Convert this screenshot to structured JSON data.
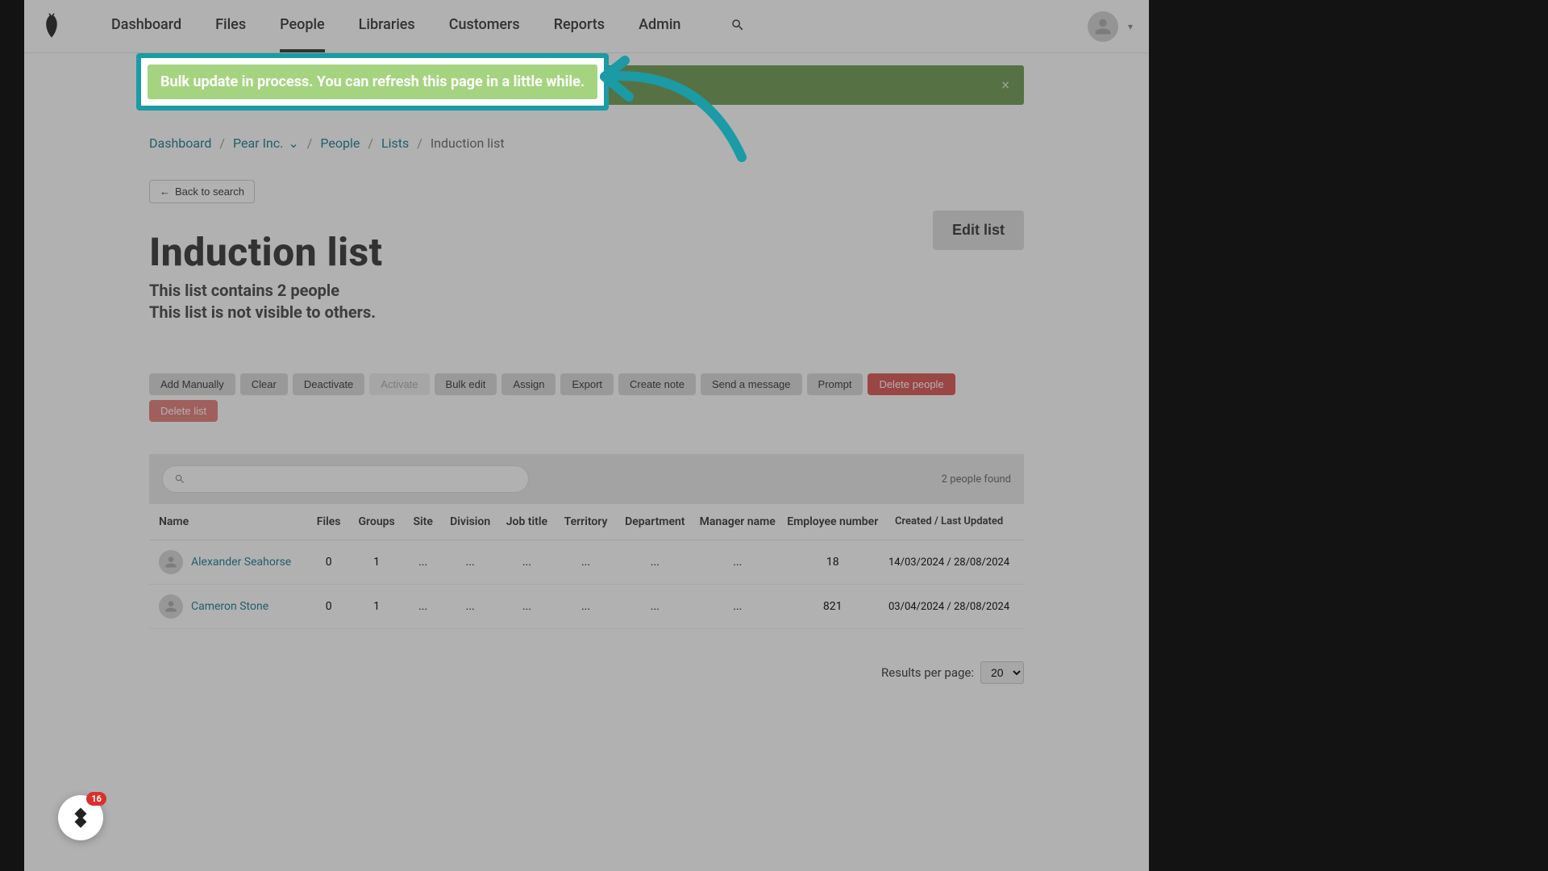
{
  "nav": {
    "items": [
      "Dashboard",
      "Files",
      "People",
      "Libraries",
      "Customers",
      "Reports",
      "Admin"
    ],
    "active_index": 2
  },
  "alert": {
    "text": "Bulk update in process. You can refresh this page in a little while."
  },
  "breadcrumb": {
    "items": [
      "Dashboard",
      "Pear Inc.",
      "People",
      "Lists",
      "Induction list"
    ]
  },
  "back_button": "Back to search",
  "page": {
    "title": "Induction list",
    "subtitle_line1": "This list contains 2 people",
    "subtitle_line2": "This list is not visible to others.",
    "edit_button": "Edit list"
  },
  "actions": [
    {
      "label": "Add Manually",
      "style": "normal"
    },
    {
      "label": "Clear",
      "style": "normal"
    },
    {
      "label": "Deactivate",
      "style": "normal"
    },
    {
      "label": "Activate",
      "style": "disabled"
    },
    {
      "label": "Bulk edit",
      "style": "normal"
    },
    {
      "label": "Assign",
      "style": "normal"
    },
    {
      "label": "Export",
      "style": "normal"
    },
    {
      "label": "Create note",
      "style": "normal"
    },
    {
      "label": "Send a message",
      "style": "normal"
    },
    {
      "label": "Prompt",
      "style": "normal"
    },
    {
      "label": "Delete people",
      "style": "danger"
    },
    {
      "label": "Delete list",
      "style": "danger-light"
    }
  ],
  "search": {
    "results_count": "2 people found"
  },
  "table": {
    "headers": [
      "Name",
      "Files",
      "Groups",
      "Site",
      "Division",
      "Job title",
      "Territory",
      "Department",
      "Manager name",
      "Employee number",
      "Created / Last Updated"
    ],
    "rows": [
      {
        "name": "Alexander Seahorse",
        "files": "0",
        "groups": "1",
        "site": "...",
        "division": "...",
        "jobtitle": "...",
        "territory": "...",
        "department": "...",
        "manager": "...",
        "empnum": "18",
        "dates": "14/03/2024 / 28/08/2024"
      },
      {
        "name": "Cameron Stone",
        "files": "0",
        "groups": "1",
        "site": "...",
        "division": "...",
        "jobtitle": "...",
        "territory": "...",
        "department": "...",
        "manager": "...",
        "empnum": "821",
        "dates": "03/04/2024 / 28/08/2024"
      }
    ]
  },
  "pager": {
    "label": "Results per page:",
    "value": "20"
  },
  "chat_badge": "16"
}
